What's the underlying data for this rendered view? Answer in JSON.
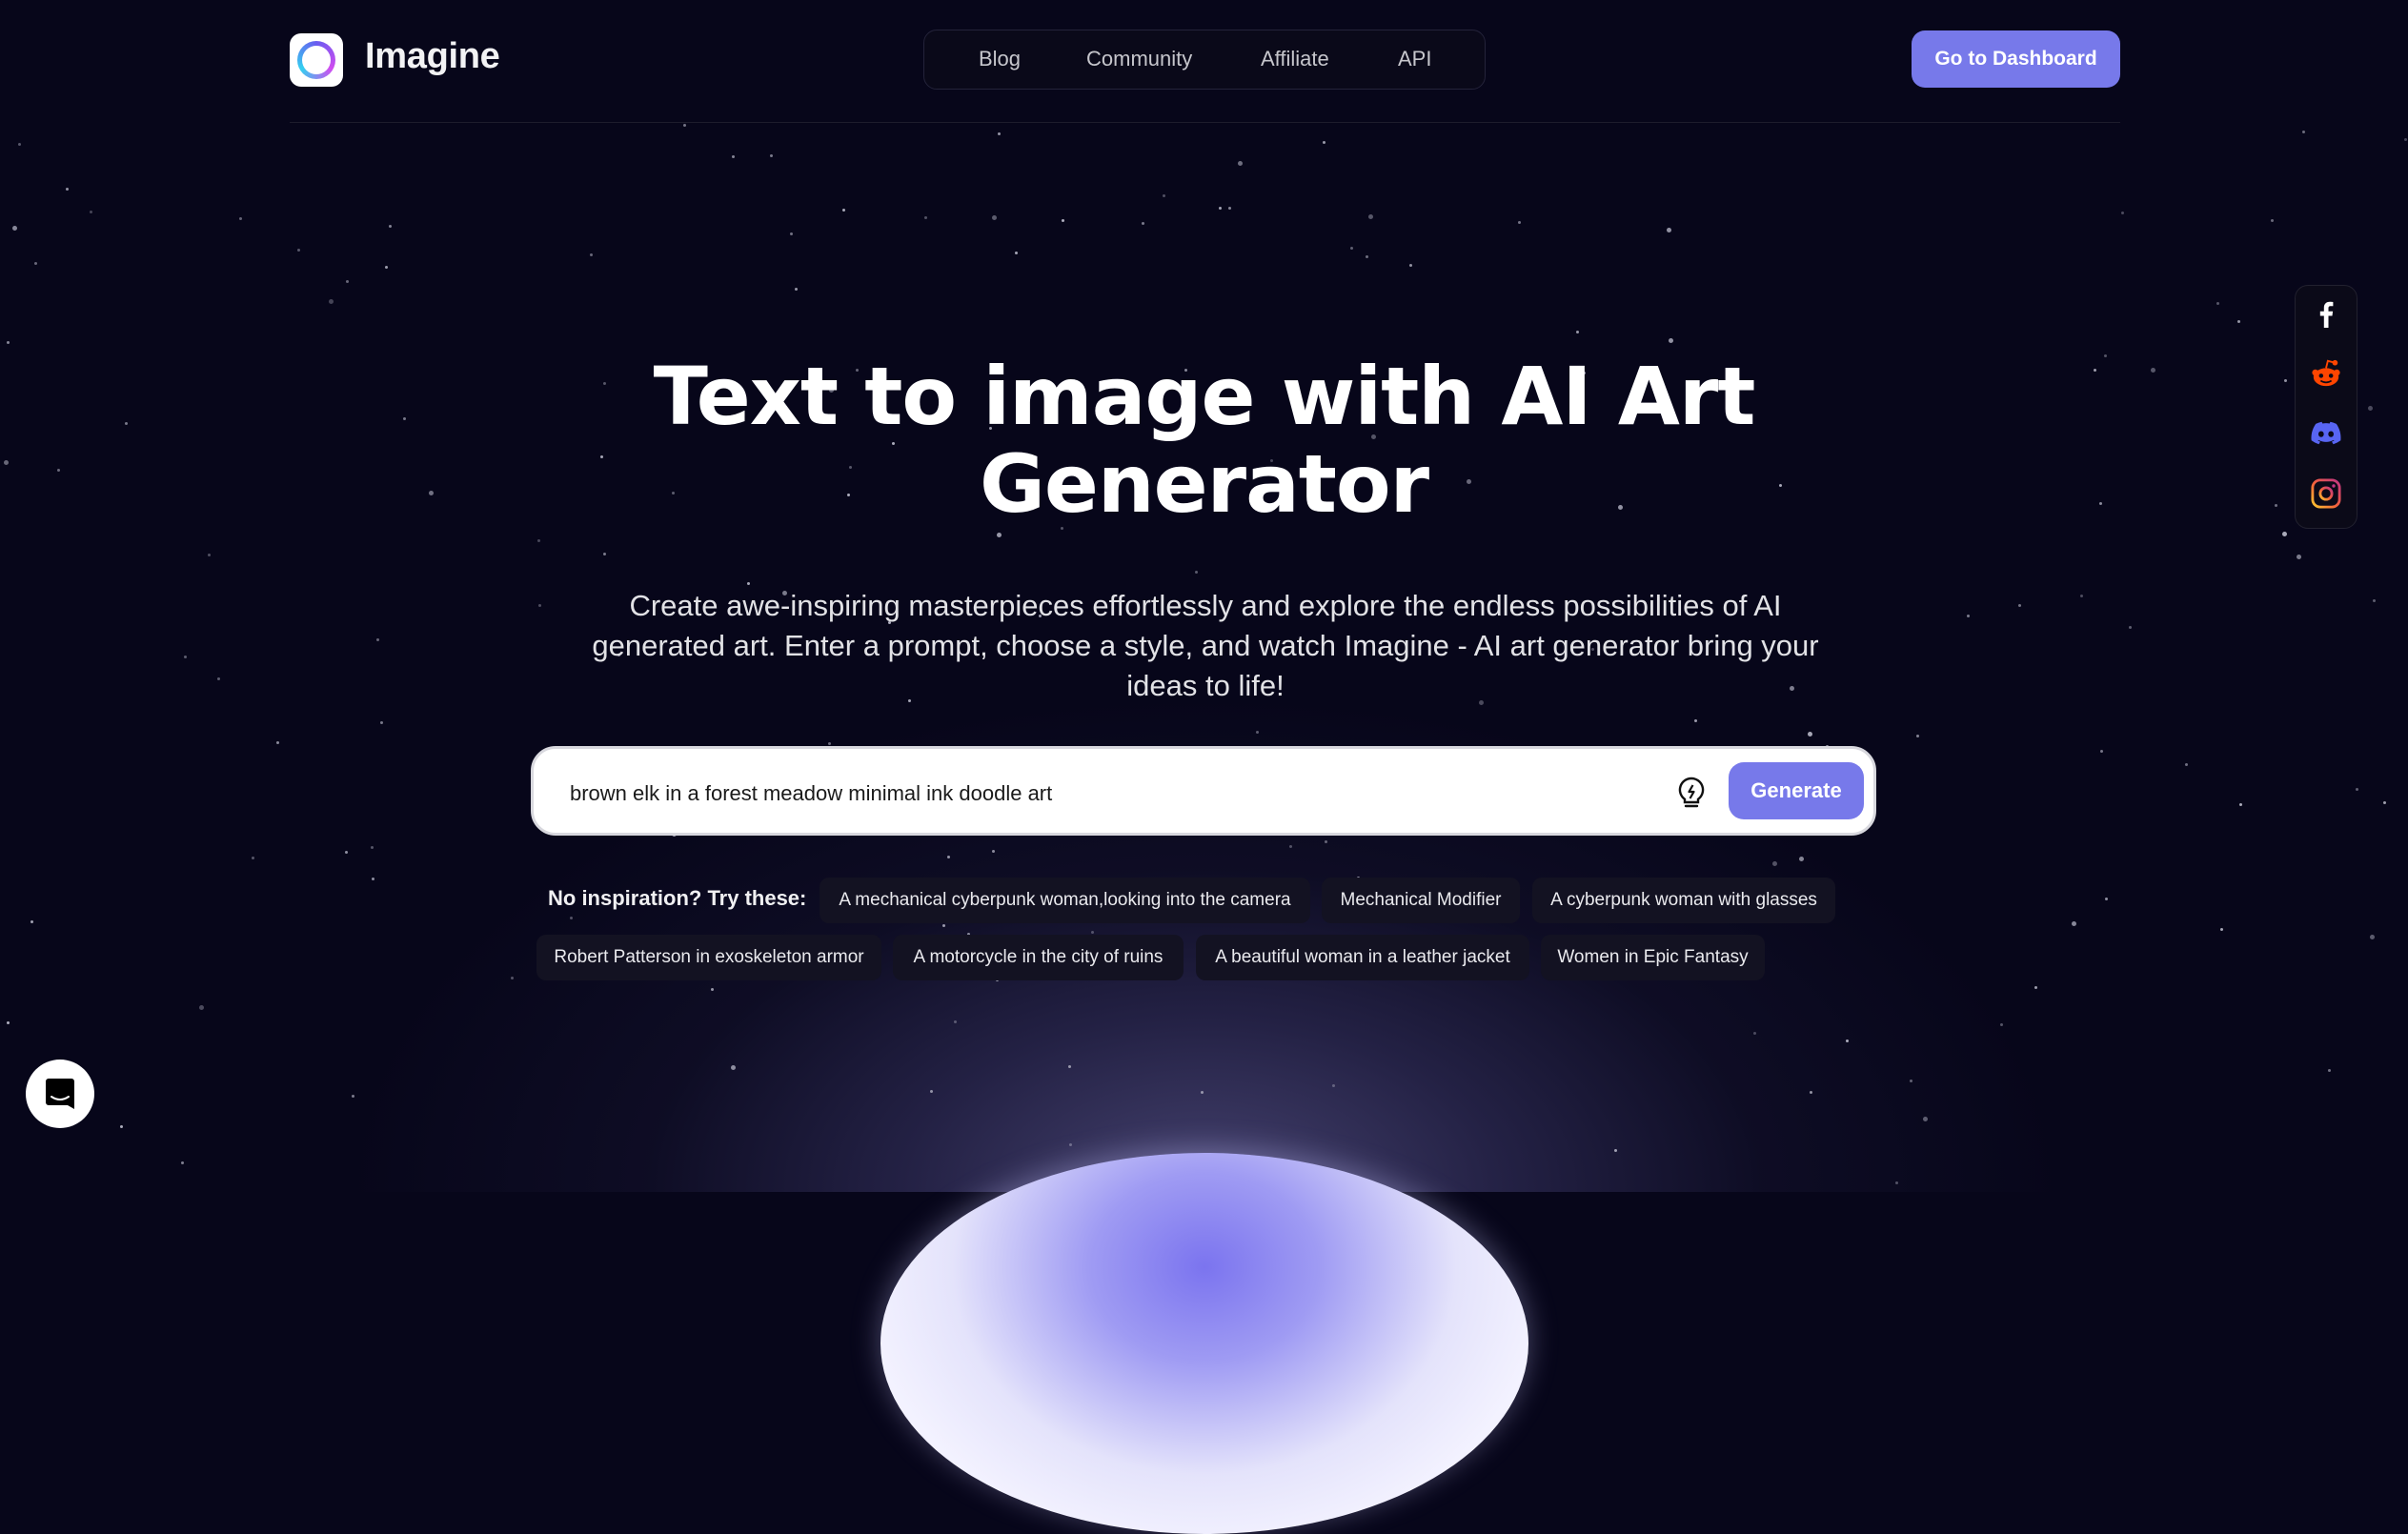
{
  "header": {
    "brand": "Imagine",
    "nav": [
      {
        "label": "Blog"
      },
      {
        "label": "Community"
      },
      {
        "label": "Affiliate"
      },
      {
        "label": "API"
      }
    ],
    "dashboard_button": "Go to Dashboard"
  },
  "social": [
    {
      "icon": "facebook-icon",
      "color": "#ffffff"
    },
    {
      "icon": "reddit-icon",
      "color": "#ff4500"
    },
    {
      "icon": "discord-icon",
      "color": "#5865f2"
    },
    {
      "icon": "instagram-icon",
      "color": "#e1306c"
    }
  ],
  "hero": {
    "title_line1": "Text to image with AI Art",
    "title_line2": "Generator",
    "subtitle": "Create awe-inspiring masterpieces effortlessly and explore the endless possibilities of AI generated art. Enter a prompt, choose a style, and watch Imagine - AI art generator bring your ideas to life!"
  },
  "prompt": {
    "value": "brown elk in a forest meadow minimal ink doodle art",
    "inspire_icon": "lightbulb-bolt-icon",
    "generate_button": "Generate"
  },
  "inspiration": {
    "label": "No inspiration? Try these:",
    "chips": [
      "A mechanical cyberpunk woman,looking into the camera",
      "Mechanical Modifier",
      "A cyberpunk woman with glasses",
      "Robert Patterson in exoskeleton armor",
      "A motorcycle in the city of ruins",
      "A beautiful woman in a leather jacket",
      "Women in Epic Fantasy"
    ]
  },
  "colors": {
    "accent": "#7779ea",
    "background": "#07061a"
  }
}
